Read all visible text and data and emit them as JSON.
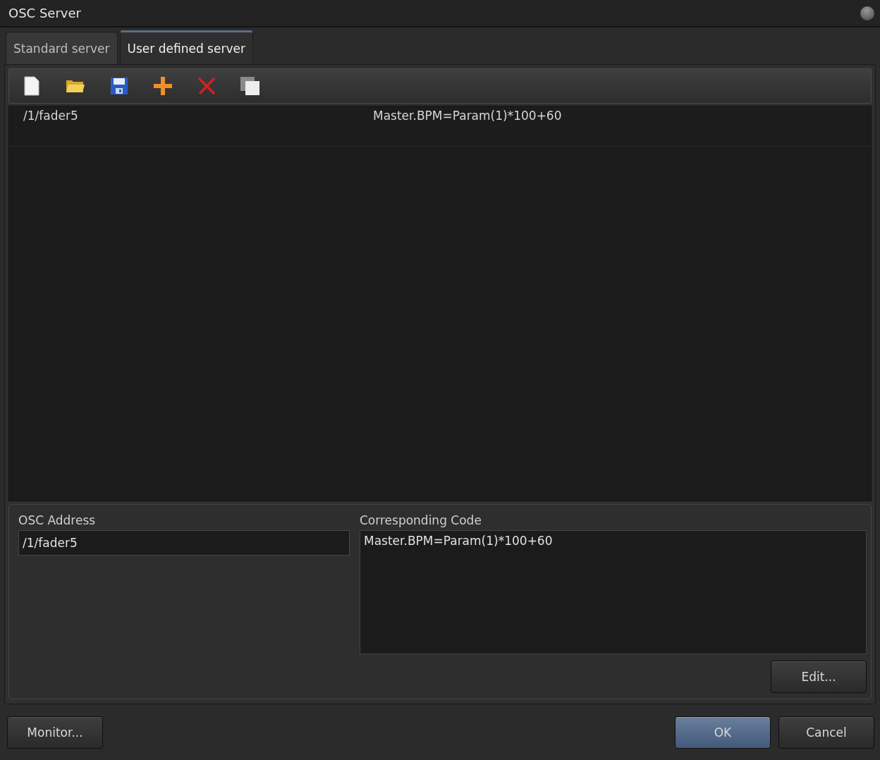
{
  "window": {
    "title": "OSC Server"
  },
  "tabs": [
    {
      "label": "Standard server",
      "selected": false
    },
    {
      "label": "User defined server",
      "selected": true
    }
  ],
  "rows": [
    {
      "address": "/1/fader5",
      "code": "Master.BPM=Param(1)*100+60"
    }
  ],
  "form": {
    "address_label": "OSC Address",
    "address_value": "/1/fader5",
    "code_label": "Corresponding Code",
    "code_value": "Master.BPM=Param(1)*100+60",
    "edit_button": "Edit..."
  },
  "footer": {
    "left_button": "Monitor...",
    "buttons": [
      {
        "label": "OK",
        "default": true
      },
      {
        "label": "Cancel",
        "default": false
      }
    ]
  }
}
